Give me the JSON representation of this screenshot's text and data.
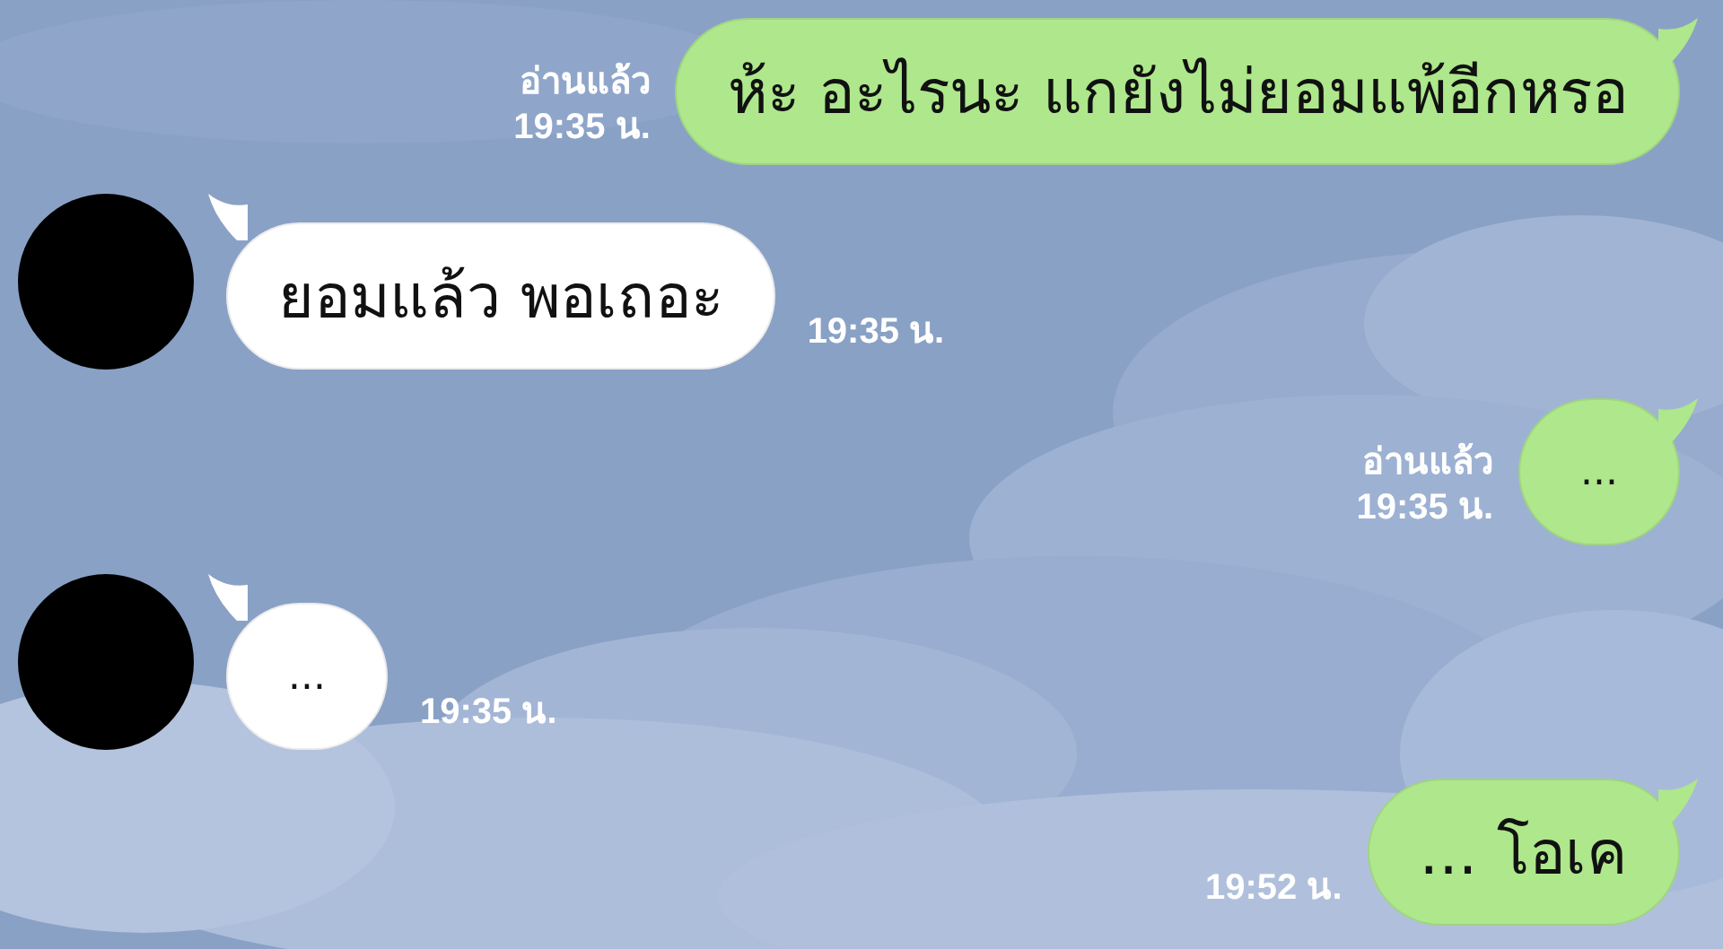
{
  "messages": [
    {
      "kind": "sent",
      "text": "ห้ะ อะไรนะ แกยังไม่ยอมแพ้อีกหรอ",
      "read": "อ่านแล้ว",
      "time": "19:35 น."
    },
    {
      "kind": "received",
      "text": "ยอมแล้ว พอเถอะ",
      "time": "19:35 น."
    },
    {
      "kind": "sent",
      "text": "...",
      "read": "อ่านแล้ว",
      "time": "19:35 น."
    },
    {
      "kind": "received",
      "text": "...",
      "time": "19:35 น."
    },
    {
      "kind": "sent",
      "text": "... โอเค",
      "time": "19:52 น."
    }
  ]
}
